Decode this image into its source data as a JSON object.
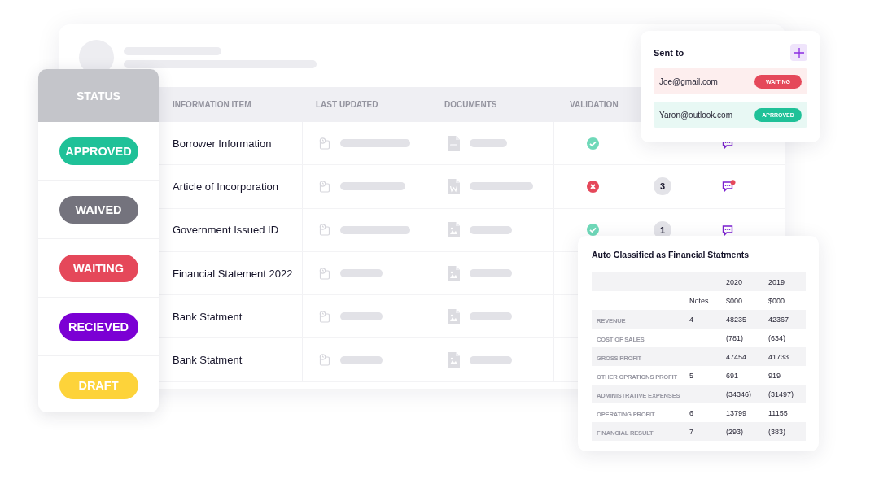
{
  "status_column": {
    "title": "STATUS",
    "items": [
      {
        "label": "APPROVED",
        "color": "#1fc198"
      },
      {
        "label": "WAIVED",
        "color": "#74737d"
      },
      {
        "label": "WAITING",
        "color": "#e5485a"
      },
      {
        "label": "RECIEVED",
        "color": "#7b00d4"
      },
      {
        "label": "DRAFT",
        "color": "#fdd33a"
      }
    ]
  },
  "table": {
    "columns": [
      "INFORMATION ITEM",
      "LAST UPDATED",
      "DOCUMENTS",
      "VALIDATION"
    ],
    "rows": [
      {
        "name": "Borrower Information",
        "document": {
          "kind": "pdf"
        },
        "validation": {
          "kind": "valid"
        },
        "comment": {
          "kind": "chat"
        }
      },
      {
        "name": "Article of Incorporation",
        "document": {
          "kind": "word"
        },
        "validation": {
          "kind": "invalid"
        },
        "count": "3",
        "comment": {
          "kind": "chat",
          "unread": true
        }
      },
      {
        "name": "Government Issued ID",
        "document": {
          "kind": "image"
        },
        "validation": {
          "kind": "valid"
        },
        "count": "1",
        "comment": {
          "kind": "chat",
          "unread": false
        }
      },
      {
        "name": "Financial Statement 2022",
        "document": {
          "kind": "image"
        }
      },
      {
        "name": "Bank Statment",
        "document": {
          "kind": "image"
        }
      },
      {
        "name": "Bank Statment",
        "document": {
          "kind": "image"
        }
      }
    ]
  },
  "sent_to": {
    "title": "Sent to",
    "recipients": [
      {
        "email": "Joe@gmail.com",
        "status": "WAITING",
        "kind": "waiting"
      },
      {
        "email": "Yaron@outlook.com",
        "status": "APRROVED",
        "kind": "approved"
      }
    ]
  },
  "financial": {
    "title": "Auto Classified as Financial Statments",
    "rows": [
      {
        "kind": "header",
        "y2020": "2020",
        "y2019": "2019"
      },
      {
        "kind": "header",
        "notes": "Notes",
        "y2020": "$000",
        "y2019": "$000"
      },
      {
        "kind": "item",
        "label": "REVENUE",
        "notes": "4",
        "y2020": "48235",
        "y2019": "42367"
      },
      {
        "kind": "item",
        "label": "COST OF SALES",
        "y2020": "(781)",
        "y2019": "(634)"
      },
      {
        "kind": "item",
        "label": "GROSS PROFIT",
        "y2020": "47454",
        "y2019": "41733"
      },
      {
        "kind": "item",
        "label": "OTHER OPRATIONS PROFIT",
        "notes": "5",
        "y2020": "691",
        "y2019": "919"
      },
      {
        "kind": "item",
        "label": "ADMINISTRATIVE EXPENSES",
        "y2020": "(34346)",
        "y2019": "(31497)"
      },
      {
        "kind": "item",
        "label": "OPERATING PROFIT",
        "notes": "6",
        "y2020": "13799",
        "y2019": "11155"
      },
      {
        "kind": "item",
        "label": "FINANCIAL RESULT",
        "notes": "7",
        "y2020": "(293)",
        "y2019": "(383)"
      }
    ]
  }
}
